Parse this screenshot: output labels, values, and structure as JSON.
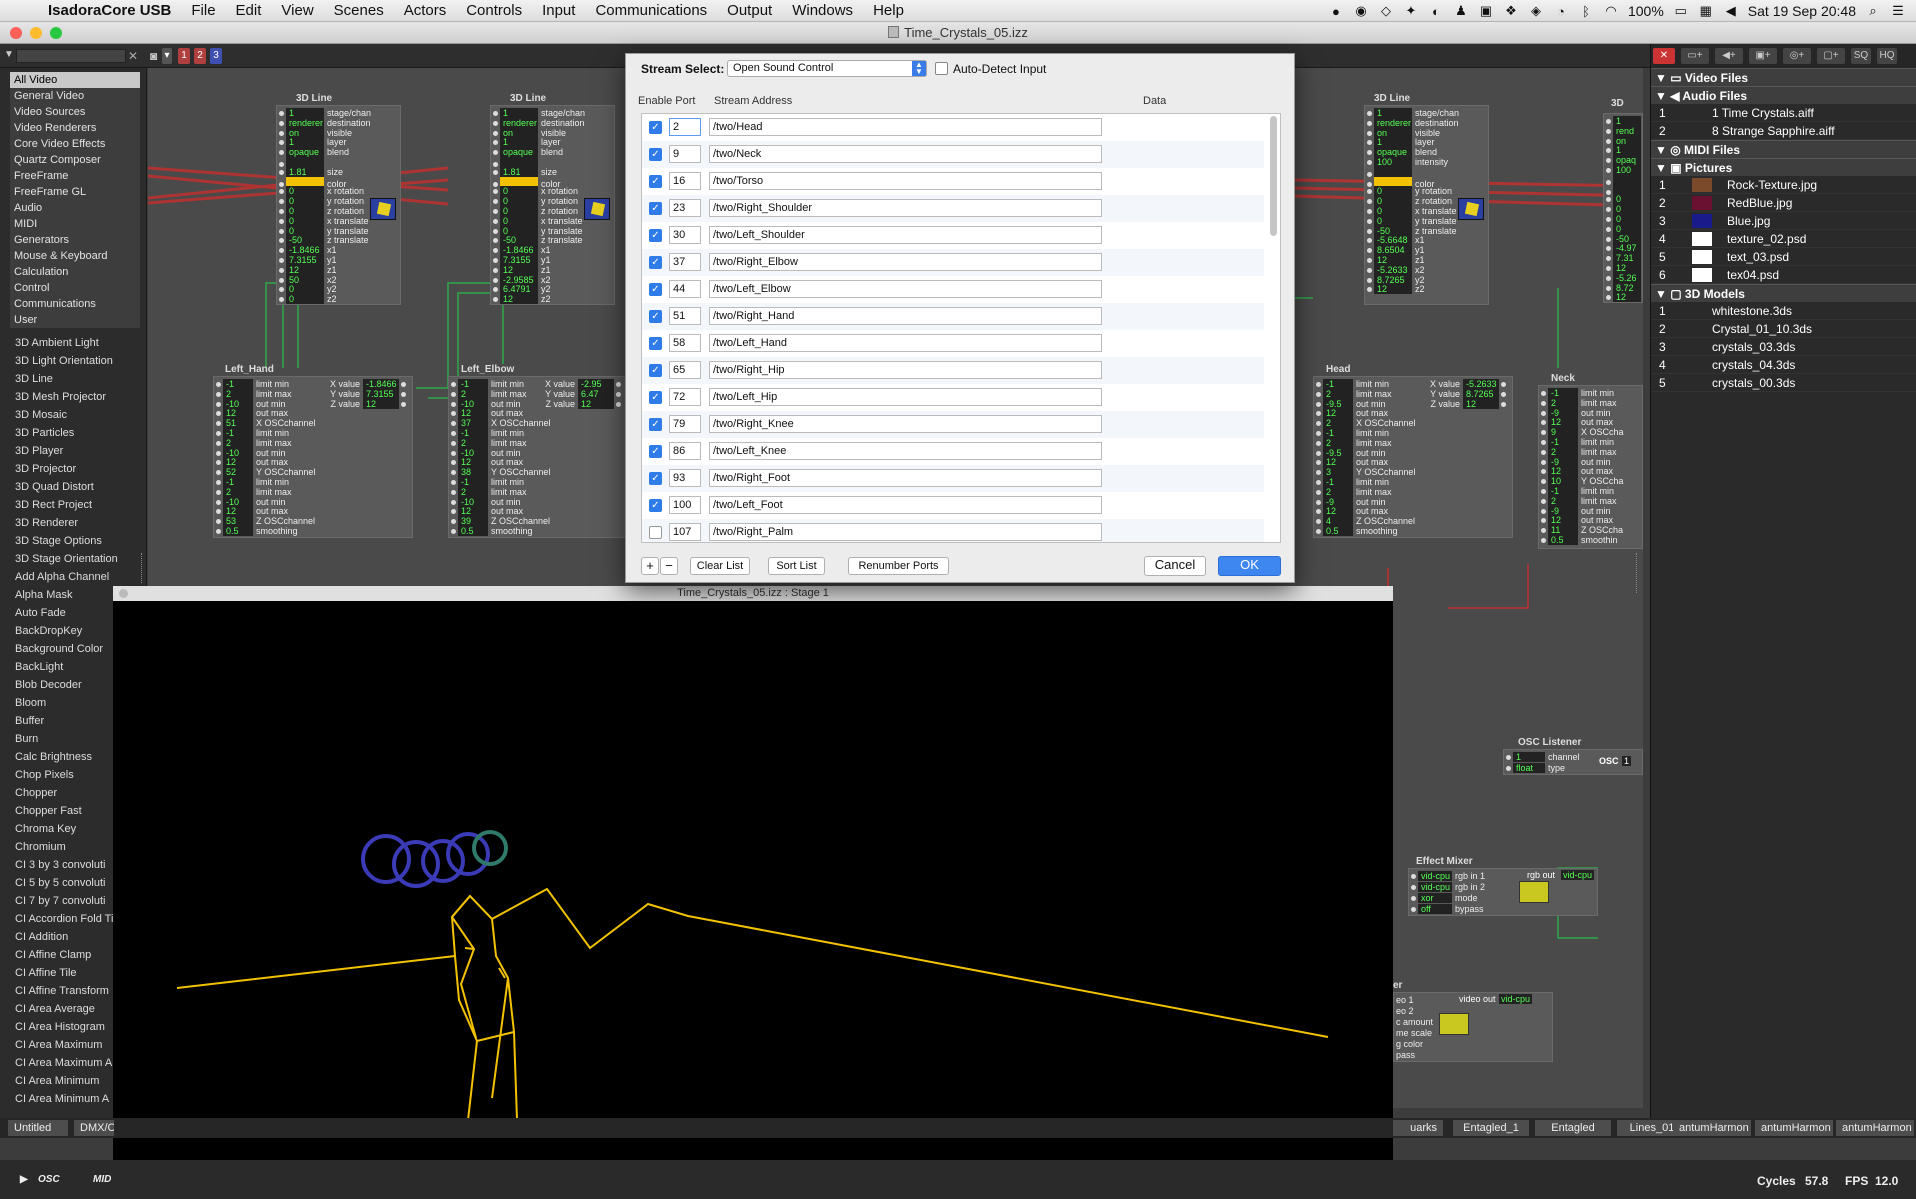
{
  "menubar": {
    "app": "IsadoraCore USB",
    "items": [
      "File",
      "Edit",
      "View",
      "Scenes",
      "Actors",
      "Controls",
      "Input",
      "Communications",
      "Output",
      "Windows",
      "Help"
    ],
    "battery": "100%",
    "clock": "Sat 19 Sep  20:48"
  },
  "window": {
    "title": "Time_Crystals_05.izz"
  },
  "toolbar": {
    "badges": [
      "1",
      "2",
      "3"
    ]
  },
  "left": {
    "categories": [
      "All Video",
      "General Video",
      "Video Sources",
      "Video Renderers",
      "Core Video Effects",
      "Quartz Composer",
      "FreeFrame",
      "FreeFrame GL",
      "Audio",
      "MIDI",
      "Generators",
      "Mouse & Keyboard",
      "Calculation",
      "Control",
      "Communications",
      "User"
    ],
    "actors": [
      "3D Ambient Light",
      "3D Light Orientation",
      "3D Line",
      "3D Mesh Projector",
      "3D Mosaic",
      "3D Particles",
      "3D Player",
      "3D Projector",
      "3D Quad Distort",
      "3D Rect Project",
      "3D Renderer",
      "3D Stage Options",
      "3D Stage Orientation",
      "Add Alpha Channel",
      "Alpha Mask",
      "Auto Fade",
      "BackDropKey",
      "Background Color",
      "BackLight",
      "Blob Decoder",
      "Bloom",
      "Buffer",
      "Burn",
      "Calc Brightness",
      "Chop Pixels",
      "Chopper",
      "Chopper Fast",
      "Chroma Key",
      "Chromium",
      "CI 3 by 3 convoluti",
      "CI 5 by 5 convoluti",
      "CI 7 by 7 convoluti",
      "CI Accordion Fold Ti",
      "CI Addition",
      "CI Affine Clamp",
      "CI Affine Tile",
      "CI Affine Transform",
      "CI Area Average",
      "CI Area Histogram",
      "CI Area Maximum",
      "CI Area Maximum A",
      "CI Area Minimum",
      "CI Area Minimum A"
    ]
  },
  "patch": {
    "line_actor_title": "3D Line",
    "line_params": [
      {
        "v": "1",
        "n": "stage/chan"
      },
      {
        "v": "renderer",
        "n": "destination"
      },
      {
        "v": "on",
        "n": "visible"
      },
      {
        "v": "1",
        "n": "layer"
      },
      {
        "v": "opaque",
        "n": "blend"
      },
      {
        "v": "",
        "n": ""
      },
      {
        "v": "1.81",
        "n": "size"
      },
      {
        "v": "",
        "n": "color"
      },
      {
        "v": "0",
        "n": "x rotation"
      },
      {
        "v": "0",
        "n": "y rotation"
      },
      {
        "v": "0",
        "n": "z rotation"
      },
      {
        "v": "0",
        "n": "x translate"
      },
      {
        "v": "0",
        "n": "y translate"
      },
      {
        "v": "-50",
        "n": "z translate"
      },
      {
        "v": "-1.8466",
        "n": "x1"
      },
      {
        "v": "7.3155",
        "n": "y1"
      },
      {
        "v": "12",
        "n": "z1"
      },
      {
        "v": "50",
        "n": "x2"
      },
      {
        "v": "0",
        "n": "y2"
      },
      {
        "v": "0",
        "n": "z2"
      }
    ],
    "line_params_2": [
      {
        "v": "1",
        "n": "stage/chan"
      },
      {
        "v": "renderer",
        "n": "destination"
      },
      {
        "v": "on",
        "n": "visible"
      },
      {
        "v": "1",
        "n": "layer"
      },
      {
        "v": "opaque",
        "n": "blend"
      },
      {
        "v": "",
        "n": ""
      },
      {
        "v": "1.81",
        "n": "size"
      },
      {
        "v": "",
        "n": "color"
      },
      {
        "v": "0",
        "n": "x rotation"
      },
      {
        "v": "0",
        "n": "y rotation"
      },
      {
        "v": "0",
        "n": "z rotation"
      },
      {
        "v": "0",
        "n": "x translate"
      },
      {
        "v": "0",
        "n": "y translate"
      },
      {
        "v": "-50",
        "n": "z translate"
      },
      {
        "v": "-1.8466",
        "n": "x1"
      },
      {
        "v": "7.3155",
        "n": "y1"
      },
      {
        "v": "12",
        "n": "z1"
      },
      {
        "v": "-2.9585",
        "n": "x2"
      },
      {
        "v": "6.4791",
        "n": "y2"
      },
      {
        "v": "12",
        "n": "z2"
      }
    ],
    "line_params_3": [
      {
        "v": "1",
        "n": "stage/chan"
      },
      {
        "v": "renderer",
        "n": "destination"
      },
      {
        "v": "on",
        "n": "visible"
      },
      {
        "v": "1",
        "n": "layer"
      },
      {
        "v": "opaque",
        "n": "blend"
      },
      {
        "v": "100",
        "n": "intensity"
      },
      {
        "v": "",
        "n": ""
      },
      {
        "v": "",
        "n": "color"
      },
      {
        "v": "0",
        "n": "y rotation"
      },
      {
        "v": "0",
        "n": "z rotation"
      },
      {
        "v": "0",
        "n": "x translate"
      },
      {
        "v": "0",
        "n": "y translate"
      },
      {
        "v": "-50",
        "n": "z translate"
      },
      {
        "v": "-5.6648",
        "n": "x1"
      },
      {
        "v": "8.6504",
        "n": "y1"
      },
      {
        "v": "12",
        "n": "z1"
      },
      {
        "v": "-5.2633",
        "n": "x2"
      },
      {
        "v": "8.7265",
        "n": "y2"
      },
      {
        "v": "12",
        "n": "z2"
      }
    ],
    "osc_titles": [
      "Left_Hand",
      "Left_Elbow",
      "Head",
      "Neck"
    ],
    "osc_params": [
      {
        "v": "-1",
        "n": "limit min"
      },
      {
        "v": "2",
        "n": "limit max"
      },
      {
        "v": "-10",
        "n": "out min"
      },
      {
        "v": "12",
        "n": "out max"
      },
      {
        "v": "51",
        "n": "X OSCchannel"
      },
      {
        "v": "-1",
        "n": "limit min"
      },
      {
        "v": "2",
        "n": "limit max"
      },
      {
        "v": "-10",
        "n": "out min"
      },
      {
        "v": "12",
        "n": "out max"
      },
      {
        "v": "52",
        "n": "Y OSCchannel"
      },
      {
        "v": "-1",
        "n": "limit min"
      },
      {
        "v": "2",
        "n": "limit max"
      },
      {
        "v": "-10",
        "n": "out min"
      },
      {
        "v": "12",
        "n": "out max"
      },
      {
        "v": "53",
        "n": "Z OSCchannel"
      },
      {
        "v": "0.5",
        "n": "smoothing"
      }
    ],
    "osc_params_2": [
      {
        "v": "-1",
        "n": "limit min"
      },
      {
        "v": "2",
        "n": "limit max"
      },
      {
        "v": "-10",
        "n": "out min"
      },
      {
        "v": "12",
        "n": "out max"
      },
      {
        "v": "37",
        "n": "X OSCchannel"
      },
      {
        "v": "-1",
        "n": "limit min"
      },
      {
        "v": "2",
        "n": "limit max"
      },
      {
        "v": "-10",
        "n": "out min"
      },
      {
        "v": "12",
        "n": "out max"
      },
      {
        "v": "38",
        "n": "Y OSCchannel"
      },
      {
        "v": "-1",
        "n": "limit min"
      },
      {
        "v": "2",
        "n": "limit max"
      },
      {
        "v": "-10",
        "n": "out min"
      },
      {
        "v": "12",
        "n": "out max"
      },
      {
        "v": "39",
        "n": "Z OSCchannel"
      },
      {
        "v": "0.5",
        "n": "smoothing"
      }
    ],
    "osc_params_3": [
      {
        "v": "-1",
        "n": "limit min"
      },
      {
        "v": "2",
        "n": "limit max"
      },
      {
        "v": "-9.5",
        "n": "out min"
      },
      {
        "v": "12",
        "n": "out max"
      },
      {
        "v": "2",
        "n": "X OSCchannel"
      },
      {
        "v": "-1",
        "n": "limit min"
      },
      {
        "v": "2",
        "n": "limit max"
      },
      {
        "v": "-9.5",
        "n": "out min"
      },
      {
        "v": "12",
        "n": "out max"
      },
      {
        "v": "3",
        "n": "Y OSCchannel"
      },
      {
        "v": "-1",
        "n": "limit min"
      },
      {
        "v": "2",
        "n": "limit max"
      },
      {
        "v": "-9",
        "n": "out min"
      },
      {
        "v": "12",
        "n": "out max"
      },
      {
        "v": "4",
        "n": "Z OSCchannel"
      },
      {
        "v": "0.5",
        "n": "smoothing"
      }
    ],
    "osc_outs": [
      {
        "n": "X value",
        "v": "-1.8466"
      },
      {
        "n": "Y value",
        "v": "7.3155"
      },
      {
        "n": "Z value",
        "v": "12"
      }
    ],
    "osc_outs_2": [
      {
        "n": "X value",
        "v": "-2.95"
      },
      {
        "n": "Y value",
        "v": "6.47"
      },
      {
        "n": "Z value",
        "v": "12"
      }
    ],
    "osc_outs_3": [
      {
        "n": "X value",
        "v": "-5.2633"
      },
      {
        "n": "Y value",
        "v": "8.7265"
      },
      {
        "n": "Z value",
        "v": "12"
      }
    ],
    "neck_params": [
      {
        "v": "-1",
        "n": "limit min"
      },
      {
        "v": "2",
        "n": "limit max"
      },
      {
        "v": "-9",
        "n": "out min"
      },
      {
        "v": "12",
        "n": "out max"
      },
      {
        "v": "9",
        "n": "X OSCcha"
      },
      {
        "v": "-1",
        "n": "limit min"
      },
      {
        "v": "2",
        "n": "limit max"
      },
      {
        "v": "-9",
        "n": "out min"
      },
      {
        "v": "12",
        "n": "out max"
      },
      {
        "v": "10",
        "n": "Y OSCcha"
      },
      {
        "v": "-1",
        "n": "limit min"
      },
      {
        "v": "2",
        "n": "limit max"
      },
      {
        "v": "-9",
        "n": "out min"
      },
      {
        "v": "12",
        "n": "out max"
      },
      {
        "v": "11",
        "n": "Z OSCcha"
      },
      {
        "v": "0.5",
        "n": "smoothin"
      }
    ],
    "line4_vals": [
      "1",
      "rend",
      "on",
      "1",
      "opaq",
      "100",
      "",
      "",
      "0",
      "0",
      "0",
      "0",
      "-50",
      "-4.97",
      "7.31",
      "12",
      "-5.26",
      "8.72",
      "12"
    ],
    "osc_listener": {
      "title": "OSC Listener",
      "rows": [
        {
          "v": "1",
          "n": "channel"
        },
        {
          "v": "float",
          "n": "type"
        }
      ],
      "out": "OSC",
      "outnum": "1"
    },
    "effect_mixer": {
      "title": "Effect Mixer",
      "rows": [
        {
          "v": "vid-cpu",
          "n": "rgb in 1"
        },
        {
          "v": "vid-cpu",
          "n": "rgb in 2"
        },
        {
          "v": "xor",
          "n": "mode"
        },
        {
          "v": "off",
          "n": "bypass"
        }
      ],
      "out_label": "rgb out",
      "out_val": "vid-cpu"
    },
    "lower_fx": {
      "title": "er",
      "rows": [
        "eo 1",
        "eo 2",
        "c amount",
        "me scale",
        "g color",
        "pass"
      ],
      "out_label": "video out",
      "out_val": "vid-cpu"
    }
  },
  "media": {
    "sections": {
      "video": "Video Files",
      "audio": "Audio Files",
      "midi": "MIDI Files",
      "pictures": "Pictures",
      "models": "3D Models"
    },
    "audio": [
      {
        "n": "1",
        "name": "1 Time Crystals.aiff"
      },
      {
        "n": "2",
        "name": "8 Strange Sapphire.aiff"
      }
    ],
    "pictures": [
      {
        "n": "1",
        "name": "Rock-Texture.jpg",
        "thumb": "#7a4a2a"
      },
      {
        "n": "2",
        "name": "RedBlue.jpg",
        "thumb": "#6a1030"
      },
      {
        "n": "3",
        "name": "Blue.jpg",
        "thumb": "#1a1a8a"
      },
      {
        "n": "4",
        "name": "texture_02.psd",
        "thumb": "#ffffff"
      },
      {
        "n": "5",
        "name": "text_03.psd",
        "thumb": "#ffffff"
      },
      {
        "n": "6",
        "name": "tex04.psd",
        "thumb": "#ffffff"
      }
    ],
    "models": [
      {
        "n": "1",
        "name": "whitestone.3ds"
      },
      {
        "n": "2",
        "name": "Crystal_01_10.3ds"
      },
      {
        "n": "3",
        "name": "crystals_03.3ds"
      },
      {
        "n": "4",
        "name": "crystals_04.3ds"
      },
      {
        "n": "5",
        "name": "crystals_00.3ds"
      }
    ]
  },
  "dialog": {
    "stream_select_label": "Stream Select:",
    "stream_select_value": "Open Sound Control",
    "auto_detect_label": "Auto-Detect Input",
    "col_enable_port": "Enable Port",
    "col_stream_address": "Stream Address",
    "col_data": "Data",
    "rows": [
      {
        "enabled": true,
        "port": "2",
        "address": "/two/Head"
      },
      {
        "enabled": true,
        "port": "9",
        "address": "/two/Neck"
      },
      {
        "enabled": true,
        "port": "16",
        "address": "/two/Torso"
      },
      {
        "enabled": true,
        "port": "23",
        "address": "/two/Right_Shoulder"
      },
      {
        "enabled": true,
        "port": "30",
        "address": "/two/Left_Shoulder"
      },
      {
        "enabled": true,
        "port": "37",
        "address": "/two/Right_Elbow"
      },
      {
        "enabled": true,
        "port": "44",
        "address": "/two/Left_Elbow"
      },
      {
        "enabled": true,
        "port": "51",
        "address": "/two/Right_Hand"
      },
      {
        "enabled": true,
        "port": "58",
        "address": "/two/Left_Hand"
      },
      {
        "enabled": true,
        "port": "65",
        "address": "/two/Right_Hip"
      },
      {
        "enabled": true,
        "port": "72",
        "address": "/two/Left_Hip"
      },
      {
        "enabled": true,
        "port": "79",
        "address": "/two/Right_Knee"
      },
      {
        "enabled": true,
        "port": "86",
        "address": "/two/Left_Knee"
      },
      {
        "enabled": true,
        "port": "93",
        "address": "/two/Right_Foot"
      },
      {
        "enabled": true,
        "port": "100",
        "address": "/two/Left_Foot"
      },
      {
        "enabled": false,
        "port": "107",
        "address": "/two/Right_Palm"
      }
    ],
    "plus": "+",
    "minus": "−",
    "clear_list": "Clear List",
    "sort_list": "Sort List",
    "renumber_ports": "Renumber Ports",
    "cancel": "Cancel",
    "ok": "OK"
  },
  "stage": {
    "title": "Time_Crystals_05.izz : Stage 1"
  },
  "scenes": {
    "left": [
      "Untitled",
      "DMX/C"
    ],
    "right": [
      "uarks",
      "Entagled_1",
      "Entagled",
      "Lines_01",
      "antumHarmon",
      "antumHarmon",
      "antumHarmon"
    ]
  },
  "status": {
    "left": [
      "OSC",
      "MID"
    ],
    "cycles_label": "Cycles",
    "cycles": "57.8",
    "fps_label": "FPS",
    "fps": "12.0"
  },
  "colors": {
    "accent": "#3e86f0",
    "value_green": "#55ff55",
    "line_yellow": "#f2c200",
    "osc_ring": "#3b3bb8",
    "wire_green": "#2ea84a",
    "wire_red": "#c03030"
  }
}
